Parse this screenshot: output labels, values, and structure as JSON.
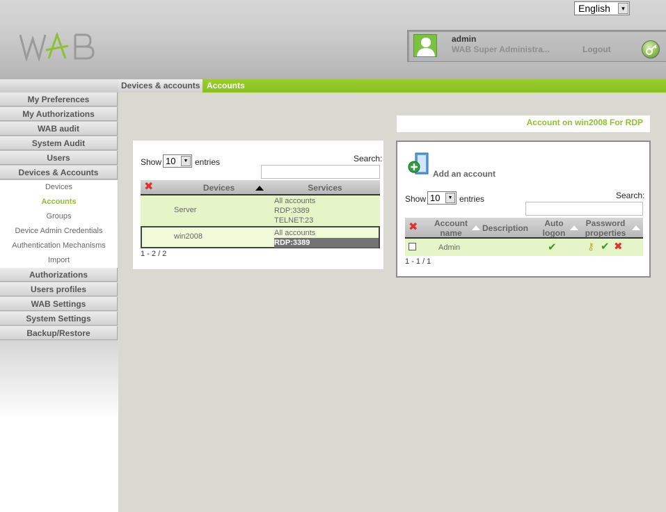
{
  "header": {
    "language": "English",
    "logo_text": "WAB",
    "user_name": "admin",
    "user_role": "WAB Super Administra...",
    "logout_label": "Logout"
  },
  "breadcrumb": {
    "parent": "Devices & accounts",
    "current": "Accounts"
  },
  "sidebar": {
    "items": [
      {
        "label": "My Preferences"
      },
      {
        "label": "My Authorizations"
      },
      {
        "label": "WAB audit"
      },
      {
        "label": "System Audit"
      },
      {
        "label": "Users"
      },
      {
        "label": "Devices & Accounts"
      }
    ],
    "subitems": [
      {
        "label": "Devices"
      },
      {
        "label": "Accounts"
      },
      {
        "label": "Groups"
      },
      {
        "label": "Device Admin Credentials"
      },
      {
        "label": "Authentication Mechanisms"
      },
      {
        "label": "Import"
      }
    ],
    "items_after": [
      {
        "label": "Authorizations"
      },
      {
        "label": "Users profiles"
      },
      {
        "label": "WAB Settings"
      },
      {
        "label": "System Settings"
      },
      {
        "label": "Backup/Restore"
      }
    ]
  },
  "devices_table": {
    "show_label": "Show",
    "entries_value": "10",
    "entries_label": "entries",
    "search_label": "Search:",
    "columns": [
      "Devices",
      "Services"
    ],
    "rows": [
      {
        "device": "Server",
        "services": [
          "All accounts",
          "RDP:3389",
          "TELNET:23"
        ]
      },
      {
        "device": "win2008",
        "services": [
          "All accounts",
          "RDP:3389"
        ]
      }
    ],
    "info": "1 - 2 / 2"
  },
  "accounts_panel": {
    "title": "Account on win2008  For RDP",
    "add_label": "Add an account",
    "show_label": "Show",
    "entries_value": "10",
    "entries_label": "entries",
    "search_label": "Search:",
    "columns": [
      "Account name",
      "Description",
      "Auto logon",
      "Password properties"
    ],
    "rows": [
      {
        "account": "Admin",
        "description": ""
      }
    ],
    "info": "1 - 1 / 1"
  }
}
